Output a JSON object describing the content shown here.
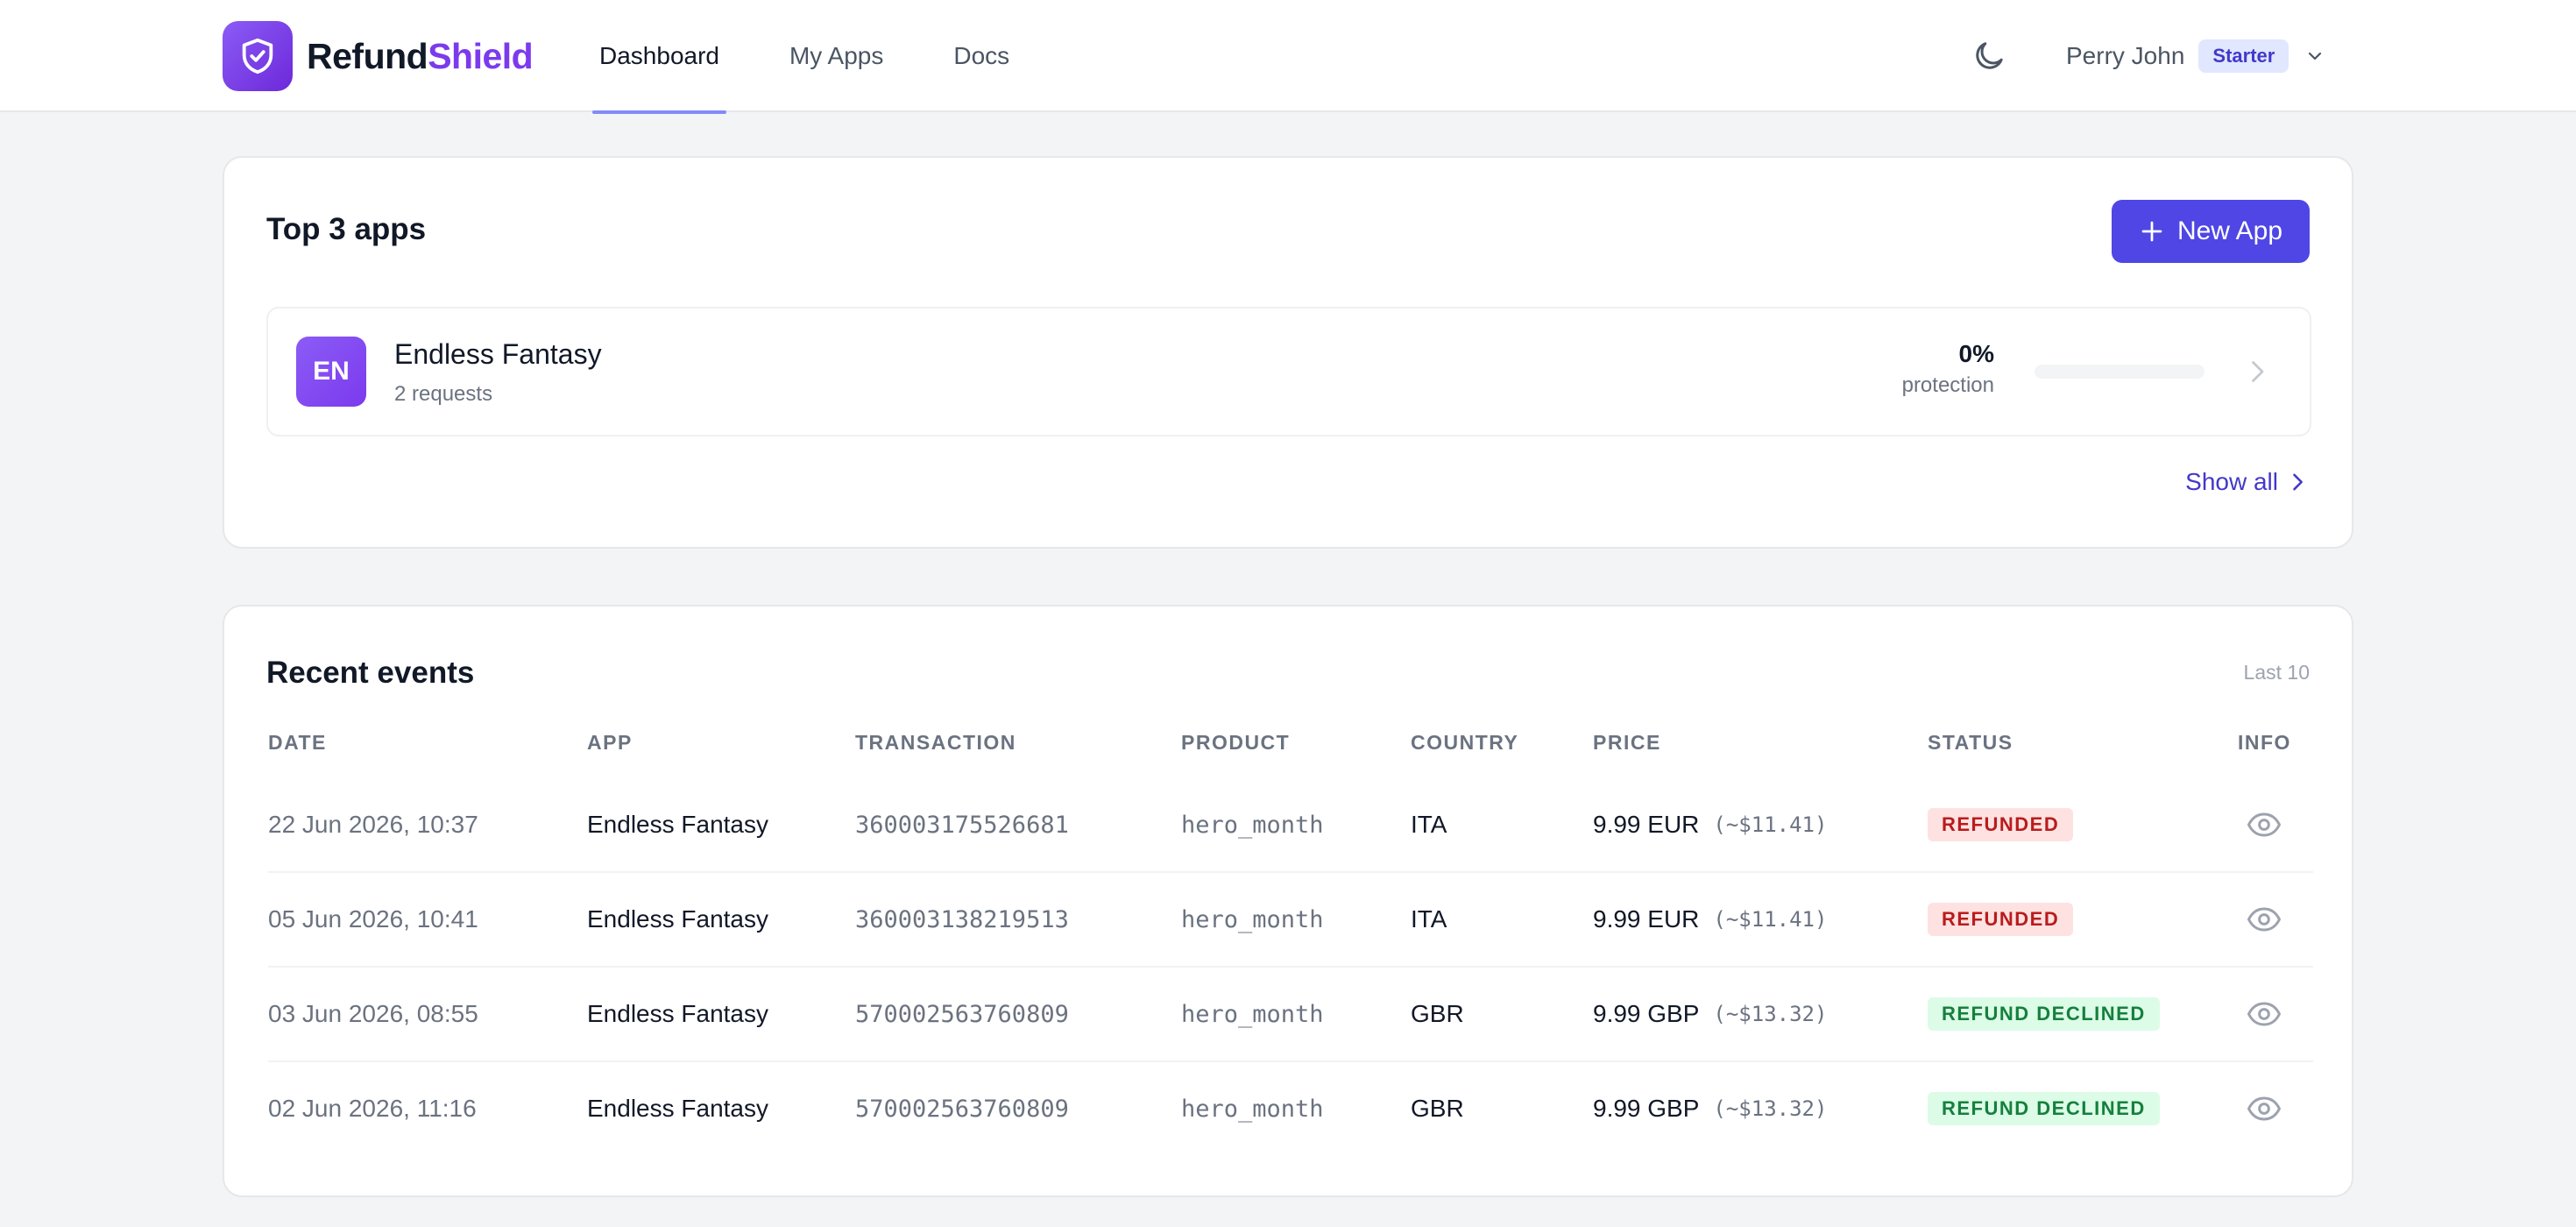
{
  "brand": {
    "part1": "Refund",
    "part2": "Shield"
  },
  "nav": [
    {
      "label": "Dashboard",
      "active": true
    },
    {
      "label": "My Apps",
      "active": false
    },
    {
      "label": "Docs",
      "active": false
    }
  ],
  "user": {
    "name": "Perry John",
    "plan": "Starter"
  },
  "top_apps": {
    "title": "Top 3 apps",
    "new_app_label": "New App",
    "apps": [
      {
        "initials": "EN",
        "name": "Endless Fantasy",
        "requests": "2 requests",
        "protection_value": "0%",
        "protection_label": "protection",
        "protection_fraction": 0
      }
    ],
    "show_all_label": "Show all"
  },
  "events": {
    "title": "Recent events",
    "subtitle": "Last 10",
    "columns": [
      "DATE",
      "APP",
      "TRANSACTION",
      "PRODUCT",
      "COUNTRY",
      "PRICE",
      "STATUS",
      "INFO"
    ],
    "rows": [
      {
        "date": "22 Jun 2026, 10:37",
        "app": "Endless Fantasy",
        "transaction": "360003175526681",
        "product": "hero_month",
        "country": "ITA",
        "price": "9.99 EUR",
        "usd": "(~$11.41)",
        "status": "REFUNDED",
        "status_kind": "refunded"
      },
      {
        "date": "05 Jun 2026, 10:41",
        "app": "Endless Fantasy",
        "transaction": "360003138219513",
        "product": "hero_month",
        "country": "ITA",
        "price": "9.99 EUR",
        "usd": "(~$11.41)",
        "status": "REFUNDED",
        "status_kind": "refunded"
      },
      {
        "date": "03 Jun 2026, 08:55",
        "app": "Endless Fantasy",
        "transaction": "570002563760809",
        "product": "hero_month",
        "country": "GBR",
        "price": "9.99 GBP",
        "usd": "(~$13.32)",
        "status": "REFUND DECLINED",
        "status_kind": "declined"
      },
      {
        "date": "02 Jun 2026, 11:16",
        "app": "Endless Fantasy",
        "transaction": "570002563760809",
        "product": "hero_month",
        "country": "GBR",
        "price": "9.99 GBP",
        "usd": "(~$13.32)",
        "status": "REFUND DECLINED",
        "status_kind": "declined"
      }
    ]
  },
  "icons": {
    "logo": "shield-check-icon",
    "theme": "moon-icon",
    "user_menu": "chevron-down-icon",
    "new_app": "plus-icon",
    "row": "chevron-right-icon",
    "info": "eye-icon"
  },
  "colors": {
    "accent": "#4f46e5",
    "brand_purple": "#7c3aed",
    "refunded_bg": "#fee2e2",
    "refunded_text": "#b91c1c",
    "declined_bg": "#dcfce7",
    "declined_text": "#15803d"
  }
}
